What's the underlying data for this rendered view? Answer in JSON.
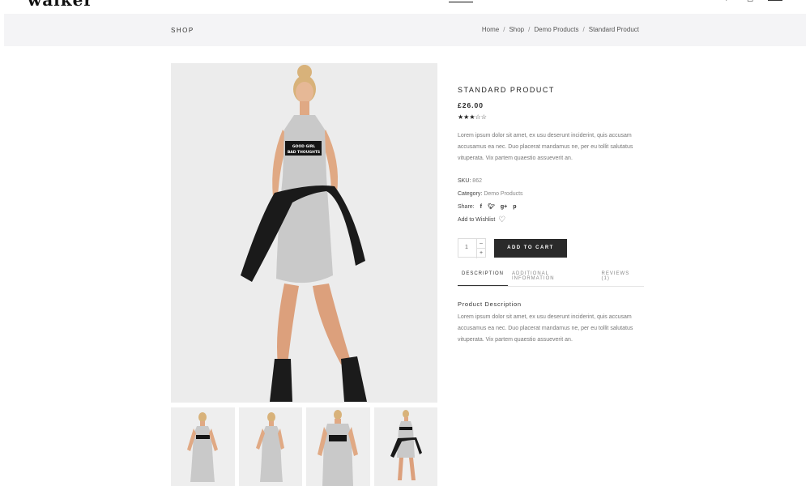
{
  "header": {
    "logo": "walker",
    "icons": [
      "search-icon",
      "cart-icon",
      "menu-icon"
    ]
  },
  "titlebar": {
    "title": "SHOP",
    "breadcrumb": [
      "Home",
      "Shop",
      "Demo Products",
      "Standard Product"
    ],
    "separator": "/"
  },
  "product": {
    "title": "STANDARD PRODUCT",
    "price": "£26.00",
    "rating": 3,
    "max_rating": 5,
    "description": "Lorem ipsum dolor sit amet, ex usu deserunt inciderint, quis accusam accusamus ea nec. Duo placerat mandamus ne, per eu tollit salutatus vituperata. Vix partem quaestio assueverit an.",
    "sku_label": "SKU:",
    "sku_value": "862",
    "category_label": "Category:",
    "category_value": "Demo Products",
    "share_label": "Share:",
    "share_icons": [
      "f",
      "t",
      "g+",
      "p"
    ],
    "wishlist_label": "Add to Wishlist",
    "quantity": "1",
    "qty_minus": "–",
    "qty_plus": "+",
    "add_to_cart": "ADD TO CART"
  },
  "tabs": [
    {
      "label": "DESCRIPTION",
      "active": true
    },
    {
      "label": "ADDITIONAL INFORMATION",
      "active": false
    },
    {
      "label": "REVIEWS (1)",
      "active": false
    }
  ],
  "product_description": {
    "title": "Product Description",
    "text": "Lorem ipsum dolor sit amet, ex usu deserunt inciderint, quis accusam accusamus ea nec. Duo placerat mandamus ne, per eu tollit salutatus vituperata. Vix partem quaestio assueverit an."
  },
  "image_text": "GOOD GIRL BAD THOUGHTS",
  "colors": {
    "accent": "#2a2a2a",
    "titlebar_bg": "#f4f4f6",
    "dress": "#c9c9c9"
  }
}
